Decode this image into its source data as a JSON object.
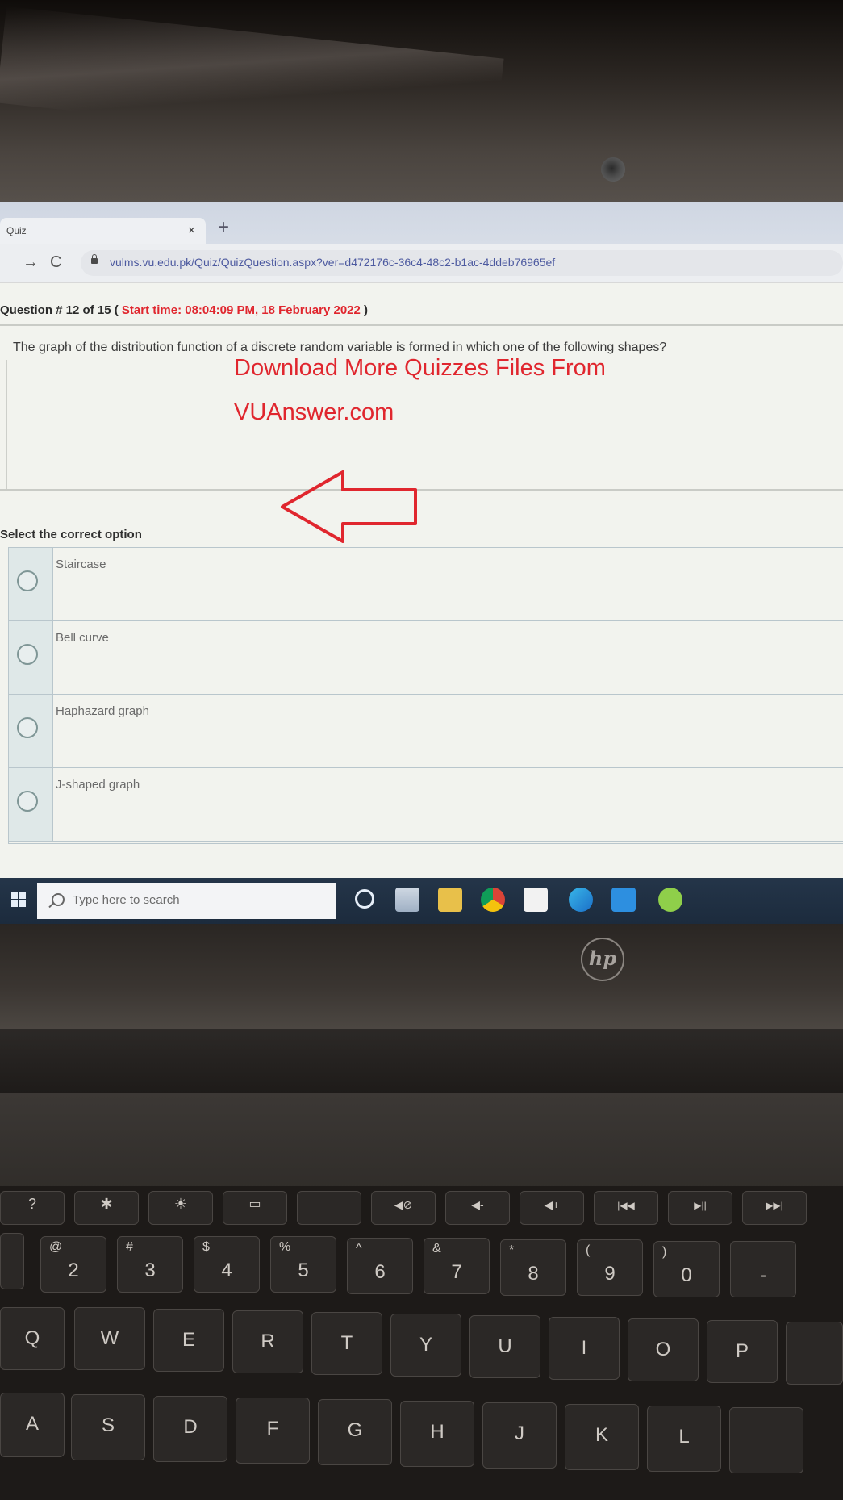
{
  "browser": {
    "tab_title": "Quiz",
    "tab_close": "×",
    "new_tab": "+",
    "nav_forward": "→",
    "nav_reload": "C",
    "url": "vulms.vu.edu.pk/Quiz/QuizQuestion.aspx?ver=d472176c-36c4-48c2-b1ac-4ddeb76965ef"
  },
  "quiz": {
    "question_number": "Question # 12 of 15 (",
    "start_time": "Start time: 08:04:09 PM, 18 February 2022",
    "question_close": ")",
    "question_text": "The graph of the distribution function of a discrete random variable is formed in which one of the following shapes?",
    "select_label": "Select the correct option",
    "options": [
      {
        "label": "Staircase"
      },
      {
        "label": "Bell curve"
      },
      {
        "label": "Haphazard graph"
      },
      {
        "label": "J-shaped graph"
      }
    ]
  },
  "watermark": {
    "line1": "Download More Quizzes Files From",
    "line2": "VUAnswer.com",
    "color": "#e0262e"
  },
  "taskbar": {
    "search_placeholder": "Type here to search"
  },
  "laptop": {
    "brand": "hp"
  },
  "keyboard": {
    "row_numbers": [
      {
        "main": "2",
        "sub": "@"
      },
      {
        "main": "3",
        "sub": "#"
      },
      {
        "main": "4",
        "sub": "$"
      },
      {
        "main": "5",
        "sub": "%"
      },
      {
        "main": "6",
        "sub": "^"
      },
      {
        "main": "7",
        "sub": "&"
      },
      {
        "main": "8",
        "sub": "*"
      },
      {
        "main": "9",
        "sub": "("
      },
      {
        "main": "0",
        "sub": ")"
      },
      {
        "main": "-",
        "sub": ""
      }
    ],
    "row_qwerty": [
      "Q",
      "W",
      "E",
      "R",
      "T",
      "Y",
      "U",
      "I",
      "O",
      "P"
    ],
    "row_asdf": [
      "A",
      "S",
      "D",
      "F",
      "G",
      "H",
      "J",
      "K",
      "L"
    ]
  }
}
